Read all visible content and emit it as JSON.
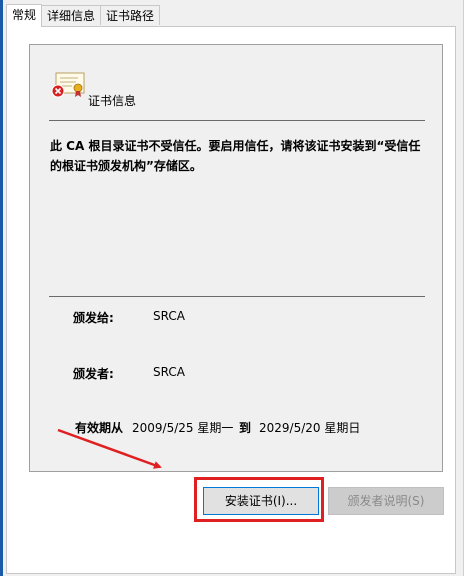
{
  "tabs": [
    {
      "label": "常规",
      "active": true
    },
    {
      "label": "详细信息",
      "active": false
    },
    {
      "label": "证书路径",
      "active": false
    }
  ],
  "info": {
    "section_title": "证书信息",
    "warning_text": "此 CA 根目录证书不受信任。要启用信任，请将该证书安装到“受信任的根证书颁发机构”存储区。",
    "issued_to_label": "颁发给:",
    "issued_to_value": "SRCA",
    "issued_by_label": "颁发者:",
    "issued_by_value": "SRCA",
    "validity_label": "有效期从",
    "valid_from": "2009/5/25 星期一",
    "to_label": "到",
    "valid_to": "2029/5/20 星期日"
  },
  "buttons": {
    "install_label": "安装证书(I)...",
    "issuer_statement_label": "颁发者说明(S)"
  },
  "colors": {
    "highlight": "#e02020",
    "focus_border": "#0078d7"
  },
  "icons": {
    "certificate": "certificate-icon",
    "error_badge": "error-badge-icon"
  }
}
